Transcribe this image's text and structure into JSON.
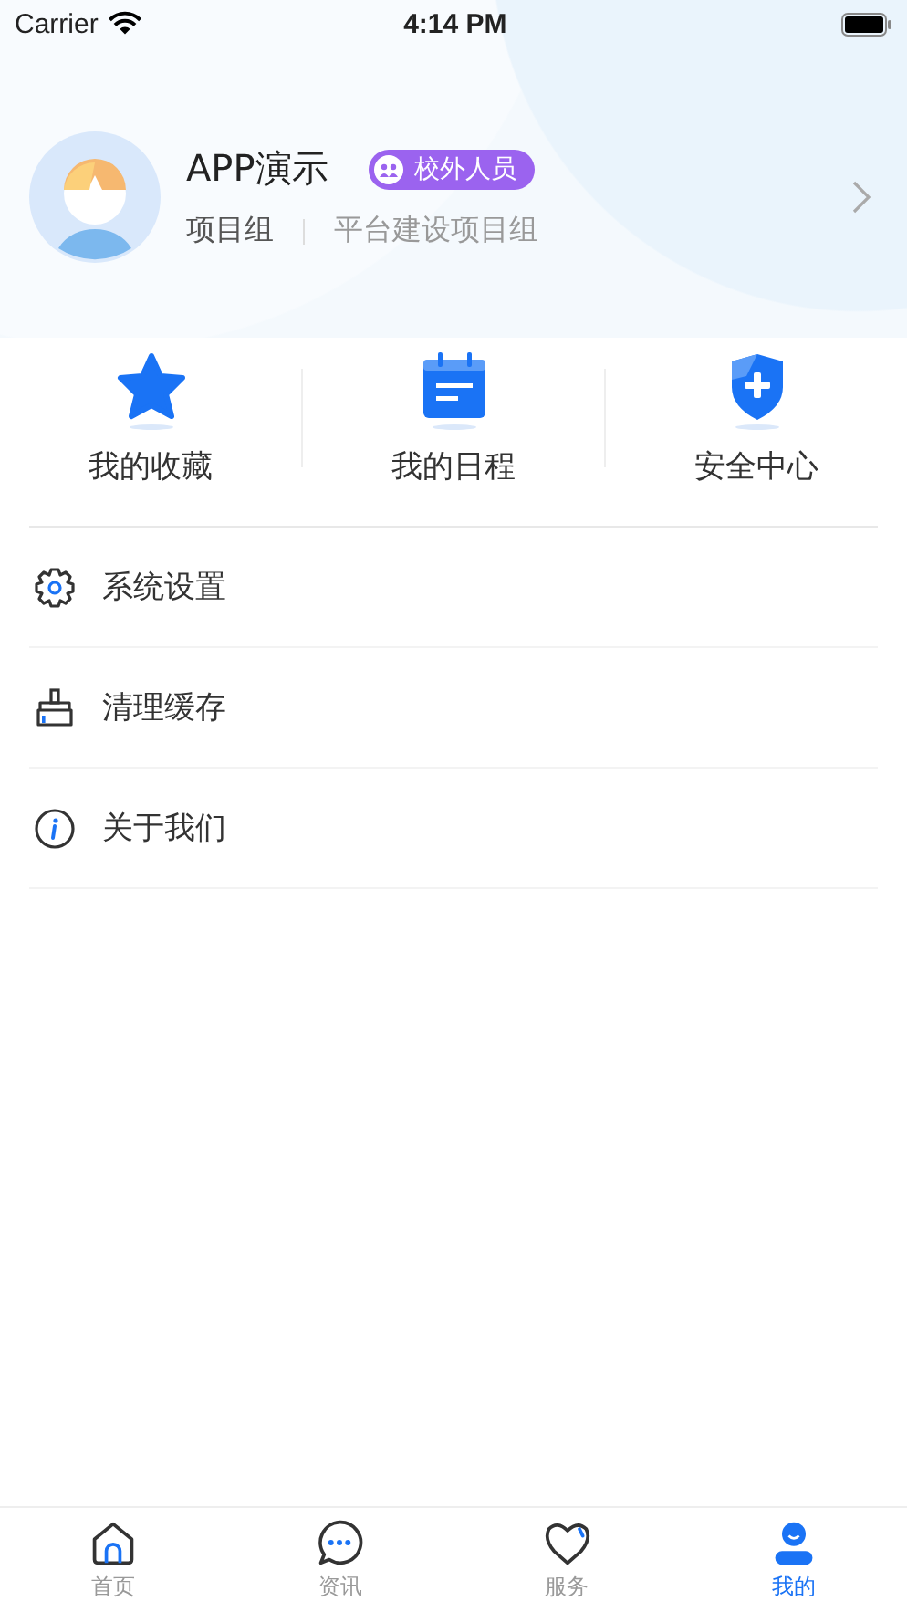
{
  "status_bar": {
    "carrier": "Carrier",
    "time": "4:14 PM"
  },
  "profile": {
    "name": "APP演示",
    "badge": "校外人员",
    "group_label": "项目组",
    "group": "平台建设项目组"
  },
  "shortcuts": [
    {
      "kind": "star",
      "label": "我的收藏"
    },
    {
      "kind": "calendar",
      "label": "我的日程"
    },
    {
      "kind": "shield",
      "label": "安全中心"
    }
  ],
  "menu": [
    {
      "kind": "settings",
      "label": "系统设置"
    },
    {
      "kind": "broom",
      "label": "清理缓存"
    },
    {
      "kind": "info",
      "label": "关于我们"
    }
  ],
  "tabs": [
    {
      "kind": "home",
      "label": "首页",
      "selected": false
    },
    {
      "kind": "chat",
      "label": "资讯",
      "selected": false
    },
    {
      "kind": "heart",
      "label": "服务",
      "selected": false
    },
    {
      "kind": "person",
      "label": "我的",
      "selected": true
    }
  ]
}
